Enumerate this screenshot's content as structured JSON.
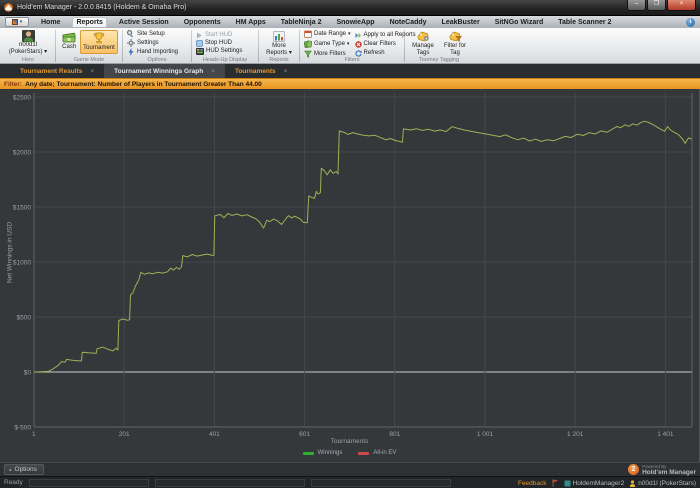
{
  "window": {
    "title": "Hold'em Manager - 2.0.0.8415 (Holdem & Omaha Pro)"
  },
  "icons": {
    "dropdown_arrow": "▾",
    "collapse_arrow": "▴",
    "close": "×",
    "minimize": "–",
    "maximize": "❐",
    "info": "i"
  },
  "menu": {
    "items": [
      "Home",
      "Reports",
      "Active Session",
      "Opponents",
      "HM Apps",
      "TableNinja 2",
      "SnowieApp",
      "NoteCaddy",
      "LeakBuster",
      "SitNGo Wizard",
      "Table Scanner 2"
    ],
    "active": "Reports"
  },
  "ribbon": {
    "hero": {
      "name": "n00d1l",
      "site": "(PokerStars)",
      "label": "Hero"
    },
    "game_mode": {
      "cash": "Cash",
      "tournament": "Tournament",
      "selected": "Tournament",
      "label": "Game Mode"
    },
    "options": {
      "items": [
        "Site Setup",
        "Settings",
        "Hand Importing"
      ],
      "label": "Options"
    },
    "hud": {
      "items": [
        "Start HUD",
        "Stop HUD",
        "HUD Settings"
      ],
      "disabled_item": "Start HUD",
      "label": "Heads-Up Display"
    },
    "reports": {
      "more_reports": "More Reports",
      "label": "Reports"
    },
    "filters": {
      "col1": [
        "Date Range",
        "Game Type",
        "More Filters"
      ],
      "col2": [
        "Apply to all Reports",
        "Clear Filters",
        "Refresh"
      ],
      "label": "Filters"
    },
    "tagging": {
      "manage_tags": "Manage Tags",
      "filter_for_tag": "Filter for Tag",
      "label": "Tourney Tagging"
    }
  },
  "tabs": [
    {
      "label": "Tournament Results",
      "active": false
    },
    {
      "label": "Tournament Winnings Graph",
      "active": true
    },
    {
      "label": "Tournaments",
      "active": false
    }
  ],
  "filter_bar": {
    "prefix": "Filter:",
    "text": "Any date; Tournament: Number of Players in Tournament Greater Than 44.00"
  },
  "chart_data": {
    "type": "line",
    "xlabel": "Tournaments",
    "ylabel": "Net Winnings in USD",
    "xlim": [
      1,
      1460
    ],
    "ylim": [
      -500,
      2500
    ],
    "x_ticks": [
      1,
      201,
      401,
      601,
      801,
      1001,
      1201,
      1401
    ],
    "x_tick_labels": [
      "1",
      "201",
      "401",
      "601",
      "801",
      "1 001",
      "1 201",
      "1 401"
    ],
    "y_ticks": [
      2500,
      2000,
      1500,
      1000,
      500,
      0,
      -500
    ],
    "y_tick_labels": [
      "$2500",
      "$2000",
      "$1500",
      "$1000",
      "$500",
      "$0",
      "$-500"
    ],
    "grid": true,
    "grid_color": "#44484c",
    "zero_line_color": "#c9cdd1",
    "border_color": "#5e6367",
    "axis_text_color": "#9aa0a5",
    "legend_position": "bottom",
    "series": [
      {
        "name": "Winnings",
        "legend_color": "#2fae2f",
        "line_color": "#a4ae57",
        "points": [
          [
            1,
            0
          ],
          [
            33,
            5
          ],
          [
            44,
            30
          ],
          [
            55,
            62
          ],
          [
            62,
            95
          ],
          [
            70,
            88
          ],
          [
            73,
            115
          ],
          [
            88,
            105
          ],
          [
            106,
            100
          ],
          [
            108,
            180
          ],
          [
            121,
            175
          ],
          [
            139,
            170
          ],
          [
            141,
            212
          ],
          [
            154,
            226
          ],
          [
            165,
            206
          ],
          [
            176,
            192
          ],
          [
            183,
            216
          ],
          [
            187,
            200
          ],
          [
            189,
            468
          ],
          [
            198,
            482
          ],
          [
            209,
            470
          ],
          [
            213,
            476
          ],
          [
            215,
            700
          ],
          [
            220,
            718
          ],
          [
            227,
            790
          ],
          [
            233,
            833
          ],
          [
            238,
            906
          ],
          [
            246,
            888
          ],
          [
            255,
            901
          ],
          [
            264,
            893
          ],
          [
            275,
            906
          ],
          [
            286,
            899
          ],
          [
            297,
            911
          ],
          [
            304,
            945
          ],
          [
            310,
            926
          ],
          [
            317,
            951
          ],
          [
            323,
            934
          ],
          [
            328,
            956
          ],
          [
            331,
            1058
          ],
          [
            341,
            1046
          ],
          [
            352,
            1068
          ],
          [
            363,
            1054
          ],
          [
            374,
            1064
          ],
          [
            385,
            1072
          ],
          [
            396,
            1060
          ],
          [
            400,
            1062
          ],
          [
            402,
            1420
          ],
          [
            414,
            1432
          ],
          [
            422,
            1402
          ],
          [
            431,
            1441
          ],
          [
            440,
            1424
          ],
          [
            451,
            1436
          ],
          [
            462,
            1419
          ],
          [
            473,
            1430
          ],
          [
            484,
            1409
          ],
          [
            495,
            1388
          ],
          [
            502,
            1358
          ],
          [
            510,
            1308
          ],
          [
            517,
            1378
          ],
          [
            524,
            1368
          ],
          [
            532,
            1390
          ],
          [
            541,
            1374
          ],
          [
            550,
            1341
          ],
          [
            559,
            1391
          ],
          [
            565,
            1421
          ],
          [
            572,
            1401
          ],
          [
            579,
            1416
          ],
          [
            585,
            1404
          ],
          [
            592,
            1389
          ],
          [
            598,
            1361
          ],
          [
            607,
            1356
          ],
          [
            610,
            1600
          ],
          [
            616,
            1588
          ],
          [
            623,
            1578
          ],
          [
            627,
            1642
          ],
          [
            631,
            1618
          ],
          [
            636,
            1630
          ],
          [
            638,
            1852
          ],
          [
            645,
            1830
          ],
          [
            651,
            1792
          ],
          [
            658,
            1838
          ],
          [
            664,
            1806
          ],
          [
            671,
            1822
          ],
          [
            675,
            1800
          ],
          [
            678,
            2192
          ],
          [
            682,
            2185
          ],
          [
            689,
            2178
          ],
          [
            697,
            2160
          ],
          [
            708,
            2176
          ],
          [
            719,
            2164
          ],
          [
            730,
            2154
          ],
          [
            744,
            2146
          ],
          [
            757,
            2152
          ],
          [
            770,
            2130
          ],
          [
            781,
            2112
          ],
          [
            792,
            2122
          ],
          [
            803,
            2104
          ],
          [
            814,
            2094
          ],
          [
            818,
            2090
          ],
          [
            820,
            2210
          ],
          [
            836,
            2200
          ],
          [
            849,
            2212
          ],
          [
            862,
            2196
          ],
          [
            876,
            2206
          ],
          [
            889,
            2190
          ],
          [
            902,
            2200
          ],
          [
            915,
            2186
          ],
          [
            928,
            2230
          ],
          [
            942,
            2214
          ],
          [
            955,
            2200
          ],
          [
            968,
            2190
          ],
          [
            981,
            2180
          ],
          [
            994,
            2170
          ],
          [
            1008,
            2160
          ],
          [
            1021,
            2150
          ],
          [
            1034,
            2140
          ],
          [
            1047,
            2156
          ],
          [
            1060,
            2130
          ],
          [
            1074,
            2112
          ],
          [
            1087,
            2126
          ],
          [
            1100,
            2100
          ],
          [
            1113,
            2116
          ],
          [
            1126,
            2096
          ],
          [
            1140,
            2112
          ],
          [
            1153,
            2102
          ],
          [
            1166,
            2122
          ],
          [
            1179,
            2142
          ],
          [
            1192,
            2132
          ],
          [
            1206,
            2162
          ],
          [
            1219,
            2150
          ],
          [
            1232,
            2176
          ],
          [
            1245,
            2164
          ],
          [
            1258,
            2192
          ],
          [
            1272,
            2180
          ],
          [
            1285,
            2212
          ],
          [
            1294,
            2232
          ],
          [
            1302,
            2220
          ],
          [
            1311,
            2246
          ],
          [
            1320,
            2234
          ],
          [
            1329,
            2256
          ],
          [
            1338,
            2244
          ],
          [
            1346,
            2266
          ],
          [
            1355,
            2280
          ],
          [
            1364,
            2268
          ],
          [
            1373,
            2250
          ],
          [
            1382,
            2228
          ],
          [
            1390,
            2208
          ],
          [
            1399,
            2188
          ],
          [
            1406,
            2232
          ],
          [
            1412,
            2200
          ],
          [
            1421,
            2178
          ],
          [
            1430,
            2158
          ],
          [
            1439,
            2118
          ],
          [
            1445,
            2078
          ],
          [
            1452,
            2128
          ],
          [
            1459,
            2118
          ]
        ]
      },
      {
        "name": "All-in EV",
        "legend_color": "#d04848",
        "line_color": "#d04848",
        "points": []
      }
    ]
  },
  "footer": {
    "options_label": "Options",
    "powered_by": "Powered By",
    "brand": "Hold'em Manager",
    "brand_number": "2"
  },
  "status_bar": {
    "ready": "Ready",
    "feedback": "Feedback",
    "account": "HoldemManager2",
    "user": "n00d1l (PokerStars)"
  }
}
